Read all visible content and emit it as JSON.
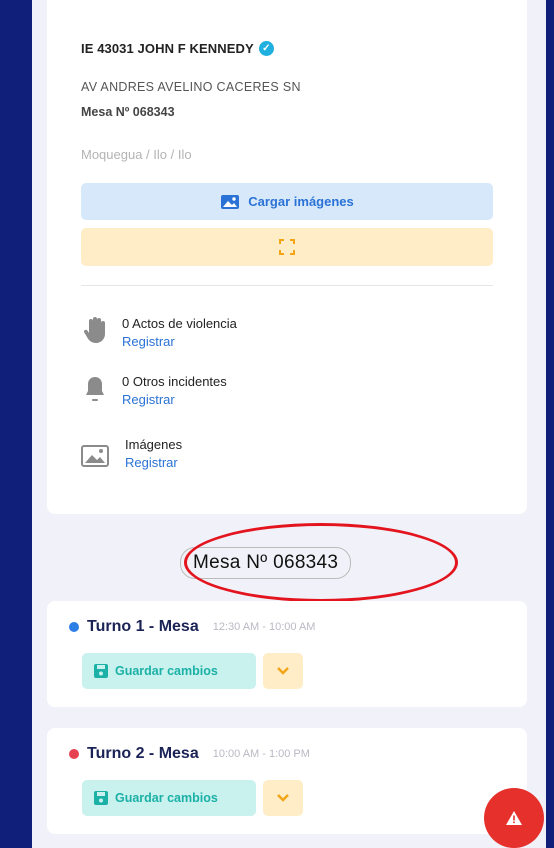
{
  "school": {
    "name": "IE 43031 JOHN F KENNEDY",
    "address": "AV ANDRES AVELINO CACERES SN",
    "mesa": "Mesa Nº 068343",
    "location": "Moquegua / Ilo / Ilo"
  },
  "actions": {
    "upload_label": "Cargar imágenes",
    "upload_icon": "image-icon",
    "scan_icon": "scan-frame-icon"
  },
  "incidents": [
    {
      "title": "0 Actos de violencia",
      "link": "Registrar",
      "icon": "hand-icon"
    },
    {
      "title": "0 Otros incidentes",
      "link": "Registrar",
      "icon": "bell-icon"
    },
    {
      "title": "Imágenes",
      "link": "Registrar",
      "icon": "image-icon"
    }
  ],
  "mesa_pill": "Mesa Nº 068343",
  "turnos": [
    {
      "title": "Turno 1 - Mesa",
      "time": "12:30 AM - 10:00 AM",
      "dot_color": "#2a7ee5",
      "save_label": "Guardar cambios"
    },
    {
      "title": "Turno 2 - Mesa",
      "time": "10:00 AM - 1:00 PM",
      "dot_color": "#e64150",
      "save_label": "Guardar cambios"
    }
  ],
  "colors": {
    "background": "#0f1f7a",
    "accent_blue": "#2a72d5",
    "teal": "#1bb1a6",
    "warning_yellow": "#feedc7",
    "alert_red": "#e6302c"
  }
}
